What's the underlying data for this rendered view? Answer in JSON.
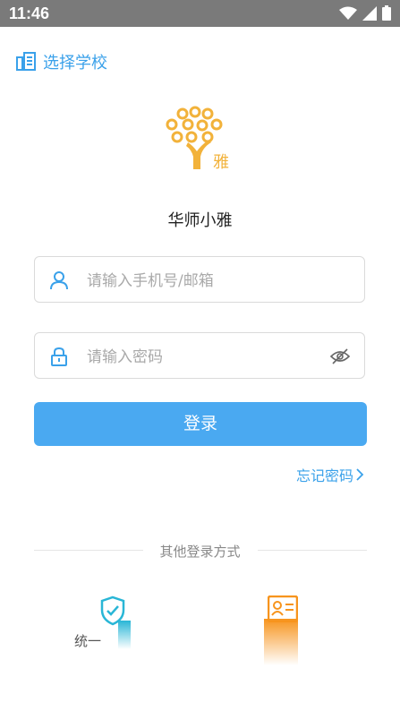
{
  "status_bar": {
    "time": "11:46"
  },
  "header": {
    "select_school_label": "选择学校"
  },
  "app": {
    "name": "华师小雅",
    "logo_text": "雅"
  },
  "form": {
    "username_placeholder": "请输入手机号/邮箱",
    "password_placeholder": "请输入密码",
    "login_label": "登录",
    "forgot_label": "忘记密码"
  },
  "other_login": {
    "title": "其他登录方式",
    "unified_label": "统一"
  },
  "colors": {
    "accent": "#3aa1ea",
    "button": "#4aa9f1",
    "logo": "#f2b23a",
    "id_card": "#f7941d",
    "shield": "#29b6d6"
  }
}
